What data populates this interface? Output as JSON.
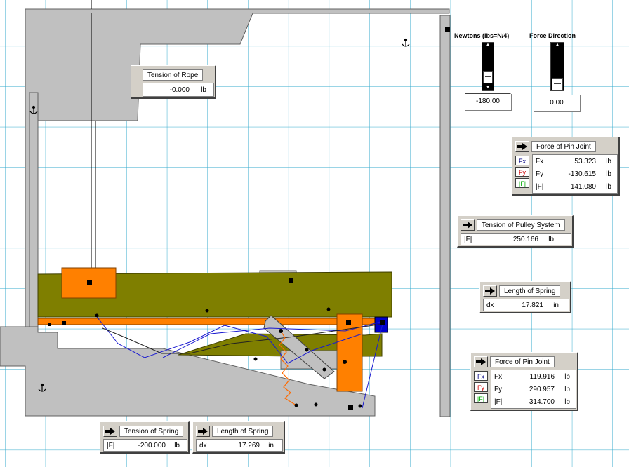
{
  "controls": {
    "newtons_label": "Newtons (lbs=N/4)",
    "newtons_value": "-180.00",
    "force_direction_label": "Force Direction",
    "force_direction_value": "0.00"
  },
  "meters": {
    "tension_rope": {
      "title": "Tension of Rope",
      "value": "-0.000",
      "unit": "lb"
    },
    "pin_joint_top": {
      "title": "Force of Pin Joint",
      "chips": [
        "Fx",
        "Fy",
        "|F|"
      ],
      "rows": [
        {
          "label": "Fx",
          "value": "53.323",
          "unit": "lb"
        },
        {
          "label": "Fy",
          "value": "-130.615",
          "unit": "lb"
        },
        {
          "label": "|F|",
          "value": "141.080",
          "unit": "lb"
        }
      ]
    },
    "pulley_tension": {
      "title": "Tension of Pulley System",
      "label": "|F|",
      "value": "250.166",
      "unit": "lb"
    },
    "spring_length_right": {
      "title": "Length of Spring",
      "label": "dx",
      "value": "17.821",
      "unit": "in"
    },
    "pin_joint_bottom": {
      "title": "Force of Pin Joint",
      "chips": [
        "Fx",
        "Fy",
        "|F|"
      ],
      "rows": [
        {
          "label": "Fx",
          "value": "119.916",
          "unit": "lb"
        },
        {
          "label": "Fy",
          "value": "290.957",
          "unit": "lb"
        },
        {
          "label": "|F|",
          "value": "314.700",
          "unit": "lb"
        }
      ]
    },
    "spring_tension": {
      "title": "Tension of Spring",
      "label": "|F|",
      "value": "-200.000",
      "unit": "lb"
    },
    "spring_length_bottom": {
      "title": "Length of Spring",
      "label": "dx",
      "value": "17.269",
      "unit": "in"
    }
  },
  "colors": {
    "grid": "#33aacc",
    "frame": "#c0c0c0",
    "beam": "#7f7f00",
    "body": "#ff8000",
    "pin": "#0000cc",
    "rope": "#1a1ad0",
    "spring": "#ff6a00",
    "chip_fx": "#000080",
    "chip_fy": "#cc0000",
    "chip_f": "#00aa00"
  },
  "icons": [
    "anchor-icon",
    "arrow-right-icon",
    "slider-thumb"
  ]
}
